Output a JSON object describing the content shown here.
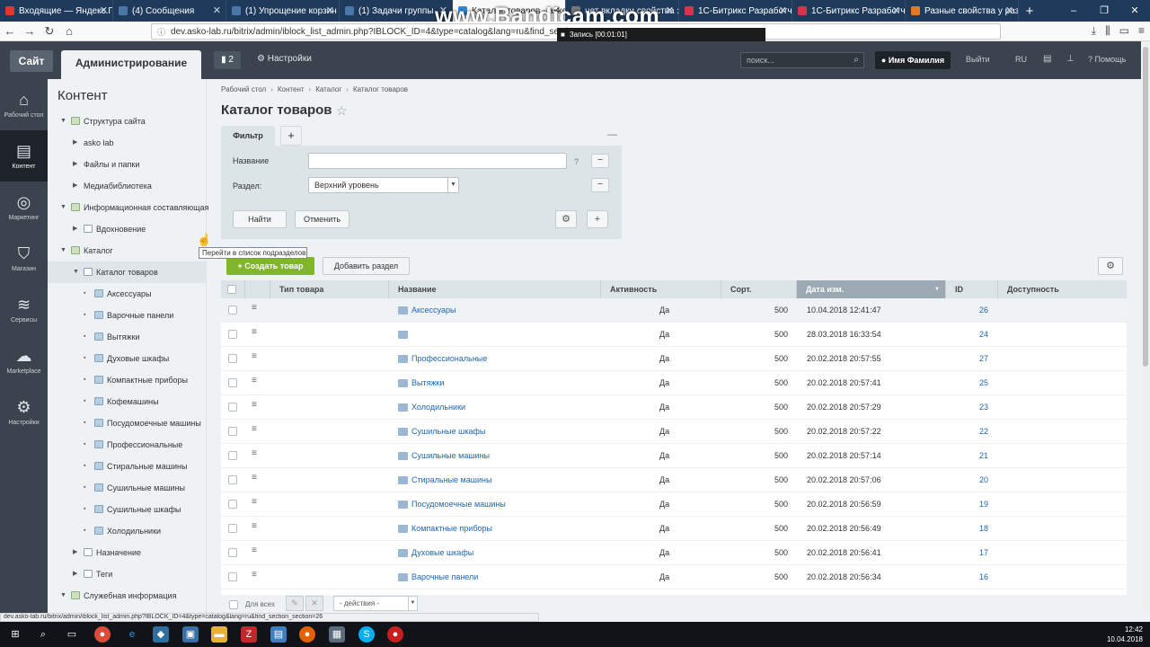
{
  "browser": {
    "tabs": [
      {
        "title": "Входящие — Яндекс.По",
        "color": "#e2372a"
      },
      {
        "title": "(4) Сообщения",
        "color": "#4a76a8"
      },
      {
        "title": "(1) Упрощение корзин",
        "color": "#4a76a8"
      },
      {
        "title": "(1) Задачи группы",
        "color": "#4a76a8"
      },
      {
        "title": "Каталог товаров - asko",
        "color": "#2d8ad9"
      },
      {
        "title": "нет вкладки свойства з",
        "color": "#777777"
      },
      {
        "title": "1С-Битрикс Разработчи",
        "color": "#d6334c"
      },
      {
        "title": "1С-Битрикс Разработчи",
        "color": "#d6334c"
      },
      {
        "title": "Разные свойства у раз",
        "color": "#e07a28"
      }
    ],
    "new_tab": "+",
    "window_controls": [
      "–",
      "❐",
      "✕"
    ],
    "watermark": "www.Bandicam.com",
    "rec_label": "Запись [00:01:01]",
    "url": "dev.asko-lab.ru/bitrix/admin/iblock_list_admin.php?IBLOCK_ID=4&type=catalog&lang=ru&find_section_",
    "status_url": "dev.asko-lab.ru/bitrix/admin/iblock_list_admin.php?IBLOCK_ID=4&type=catalog&lang=ru&find_section_section=26"
  },
  "panel": {
    "site": "Сайт",
    "admin": "Администрирование",
    "notifications": "2",
    "settings": "Настройки",
    "search_placeholder": "поиск...",
    "user": "Имя Фамилия",
    "logout": "Выйти",
    "lang": "RU",
    "help": "Помощь"
  },
  "leftmenu": [
    {
      "icon": "⌂",
      "label": "Рабочий стол"
    },
    {
      "icon": "▤",
      "label": "Контент"
    },
    {
      "icon": "◎",
      "label": "Маркетинг"
    },
    {
      "icon": "⛉",
      "label": "Магазин"
    },
    {
      "icon": "≋",
      "label": "Сервисы"
    },
    {
      "icon": "☁",
      "label": "Marketplace"
    },
    {
      "icon": "⚙",
      "label": "Настройки"
    }
  ],
  "tree": {
    "title": "Контент",
    "items": [
      {
        "label": "Структура сайта",
        "level": 0,
        "arrow": "▼",
        "icon": "sq"
      },
      {
        "label": "asko lab",
        "level": 1,
        "arrow": "▶",
        "icon": ""
      },
      {
        "label": "Файлы и папки",
        "level": 1,
        "arrow": "▶",
        "icon": ""
      },
      {
        "label": "Медиабиблиотека",
        "level": 1,
        "arrow": "▶",
        "icon": ""
      },
      {
        "label": "Информационная составляющая",
        "level": 0,
        "arrow": "▼",
        "icon": "sq"
      },
      {
        "label": "Вдохновение",
        "level": 1,
        "arrow": "▶",
        "icon": "doc"
      },
      {
        "label": "Каталог",
        "level": 0,
        "arrow": "▼",
        "icon": "sq"
      },
      {
        "label": "Каталог товаров",
        "level": 1,
        "arrow": "▼",
        "icon": "doc"
      },
      {
        "label": "Аксессуары",
        "level": 2,
        "arrow": "▪",
        "icon": "folder"
      },
      {
        "label": "Варочные панели",
        "level": 2,
        "arrow": "▪",
        "icon": "folder"
      },
      {
        "label": "Вытяжки",
        "level": 2,
        "arrow": "▪",
        "icon": "folder"
      },
      {
        "label": "Духовые шкафы",
        "level": 2,
        "arrow": "▪",
        "icon": "folder"
      },
      {
        "label": "Компактные приборы",
        "level": 2,
        "arrow": "▪",
        "icon": "folder"
      },
      {
        "label": "Кофемашины",
        "level": 2,
        "arrow": "▪",
        "icon": "folder"
      },
      {
        "label": "Посудомоечные машины",
        "level": 2,
        "arrow": "▪",
        "icon": "folder"
      },
      {
        "label": "Профессиональные",
        "level": 2,
        "arrow": "▪",
        "icon": "folder"
      },
      {
        "label": "Стиральные машины",
        "level": 2,
        "arrow": "▪",
        "icon": "folder"
      },
      {
        "label": "Сушильные машины",
        "level": 2,
        "arrow": "▪",
        "icon": "folder"
      },
      {
        "label": "Сушильные шкафы",
        "level": 2,
        "arrow": "▪",
        "icon": "folder"
      },
      {
        "label": "Холодильники",
        "level": 2,
        "arrow": "▪",
        "icon": "folder"
      },
      {
        "label": "Назначение",
        "level": 1,
        "arrow": "▶",
        "icon": "doc"
      },
      {
        "label": "Теги",
        "level": 1,
        "arrow": "▶",
        "icon": "doc"
      },
      {
        "label": "Служебная информация",
        "level": 0,
        "arrow": "▼",
        "icon": "sq"
      }
    ]
  },
  "main": {
    "breadcrumb": [
      "Рабочий стол",
      "Контент",
      "Каталог",
      "Каталог товаров"
    ],
    "title": "Каталог товаров",
    "filter": {
      "tab": "Фильтр",
      "add_tab": "+",
      "name_label": "Название",
      "name_value": "",
      "help": "?",
      "section_label": "Раздел:",
      "section_value": "Верхний уровень",
      "find": "Найти",
      "cancel": "Отменить"
    },
    "create_button": "Создать товар",
    "add_section_button": "Добавить раздел",
    "columns": [
      "Тип товара",
      "Название",
      "Активность",
      "Сорт.",
      "Дата изм.",
      "ID",
      "Доступность"
    ],
    "rows": [
      {
        "name": "Аксессуары",
        "active": "Да",
        "sort": "500",
        "date": "10.04.2018 12:41:47",
        "id": "26"
      },
      {
        "name": "",
        "active": "Да",
        "sort": "500",
        "date": "28.03.2018 16:33:54",
        "id": "24"
      },
      {
        "name": "Профессиональные",
        "active": "Да",
        "sort": "500",
        "date": "20.02.2018 20:57:55",
        "id": "27"
      },
      {
        "name": "Вытяжки",
        "active": "Да",
        "sort": "500",
        "date": "20.02.2018 20:57:41",
        "id": "25"
      },
      {
        "name": "Холодильники",
        "active": "Да",
        "sort": "500",
        "date": "20.02.2018 20:57:29",
        "id": "23"
      },
      {
        "name": "Сушильные шкафы",
        "active": "Да",
        "sort": "500",
        "date": "20.02.2018 20:57:22",
        "id": "22"
      },
      {
        "name": "Сушильные машины",
        "active": "Да",
        "sort": "500",
        "date": "20.02.2018 20:57:14",
        "id": "21"
      },
      {
        "name": "Стиральные машины",
        "active": "Да",
        "sort": "500",
        "date": "20.02.2018 20:57:06",
        "id": "20"
      },
      {
        "name": "Посудомоечные машины",
        "active": "Да",
        "sort": "500",
        "date": "20.02.2018 20:56:59",
        "id": "19"
      },
      {
        "name": "Компактные приборы",
        "active": "Да",
        "sort": "500",
        "date": "20.02.2018 20:56:49",
        "id": "18"
      },
      {
        "name": "Духовые шкафы",
        "active": "Да",
        "sort": "500",
        "date": "20.02.2018 20:56:41",
        "id": "17"
      },
      {
        "name": "Варочные панели",
        "active": "Да",
        "sort": "500",
        "date": "20.02.2018 20:56:34",
        "id": "16"
      }
    ],
    "tooltip": "Перейти в список подразделов",
    "footer": {
      "for_all": "Для всех",
      "actions": "- действия -"
    }
  },
  "taskbar": {
    "time": "12:42",
    "date": "10.04.2018"
  }
}
